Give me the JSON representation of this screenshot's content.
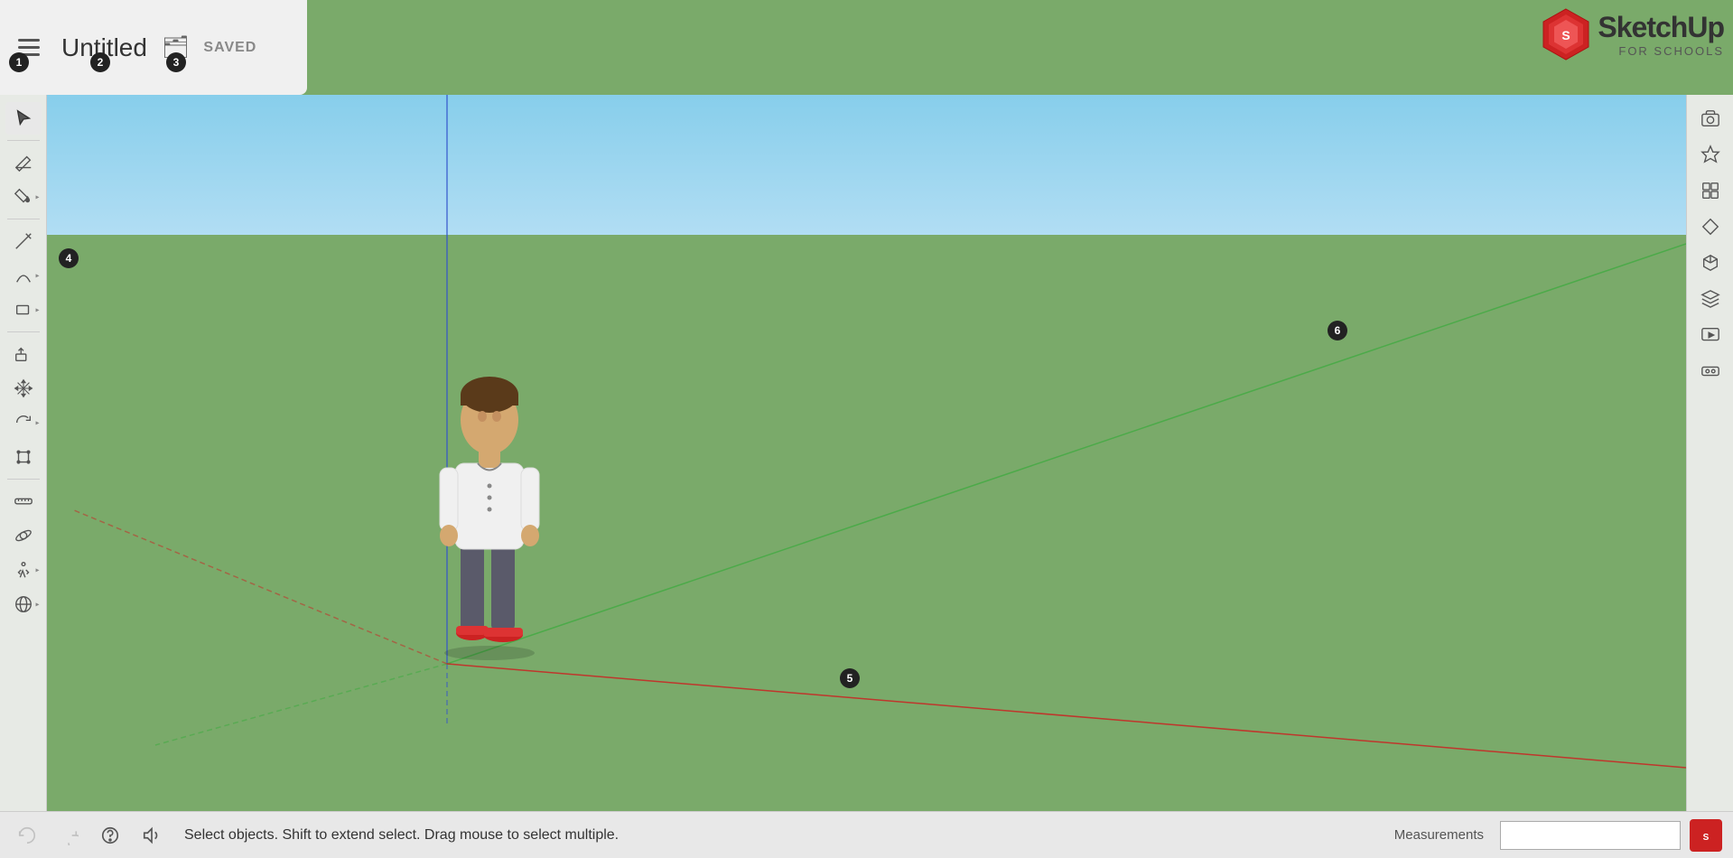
{
  "header": {
    "title": "Untitled",
    "saved_label": "SAVED",
    "menu_icon": "☰"
  },
  "logo": {
    "sketchup": "SketchUp",
    "forschools": "FOR SCHOOLS"
  },
  "toolbar": {
    "tools": [
      {
        "name": "select",
        "icon": "cursor",
        "expandable": false
      },
      {
        "name": "eraser",
        "icon": "eraser",
        "expandable": false
      },
      {
        "name": "paint-bucket",
        "icon": "paint",
        "expandable": true
      },
      {
        "name": "pencil",
        "icon": "pencil",
        "expandable": false
      },
      {
        "name": "arc",
        "icon": "arc",
        "expandable": true
      },
      {
        "name": "shapes",
        "icon": "shapes",
        "expandable": true
      },
      {
        "name": "push-pull",
        "icon": "pushpull",
        "expandable": false
      },
      {
        "name": "move",
        "icon": "move",
        "expandable": false
      },
      {
        "name": "rotate",
        "icon": "rotate",
        "expandable": true
      },
      {
        "name": "scale",
        "icon": "scale",
        "expandable": false
      },
      {
        "name": "tape-measure",
        "icon": "tape",
        "expandable": false
      },
      {
        "name": "orbit",
        "icon": "orbit",
        "expandable": false
      }
    ]
  },
  "right_panel": {
    "tools": [
      {
        "name": "camera",
        "icon": "camera"
      },
      {
        "name": "styles",
        "icon": "styles"
      },
      {
        "name": "components",
        "icon": "components"
      },
      {
        "name": "views",
        "icon": "views"
      },
      {
        "name": "iso-view",
        "icon": "isoview"
      },
      {
        "name": "layers",
        "icon": "layers"
      },
      {
        "name": "scenes",
        "icon": "scenes"
      },
      {
        "name": "vr",
        "icon": "vr"
      }
    ]
  },
  "badges": {
    "b1": "1",
    "b2": "2",
    "b3": "3",
    "b4": "4",
    "b5": "5",
    "b6": "6"
  },
  "bottom_bar": {
    "status": "Select objects. Shift to extend select. Drag mouse to select multiple.",
    "measurements_label": "Measurements",
    "measurements_value": ""
  }
}
